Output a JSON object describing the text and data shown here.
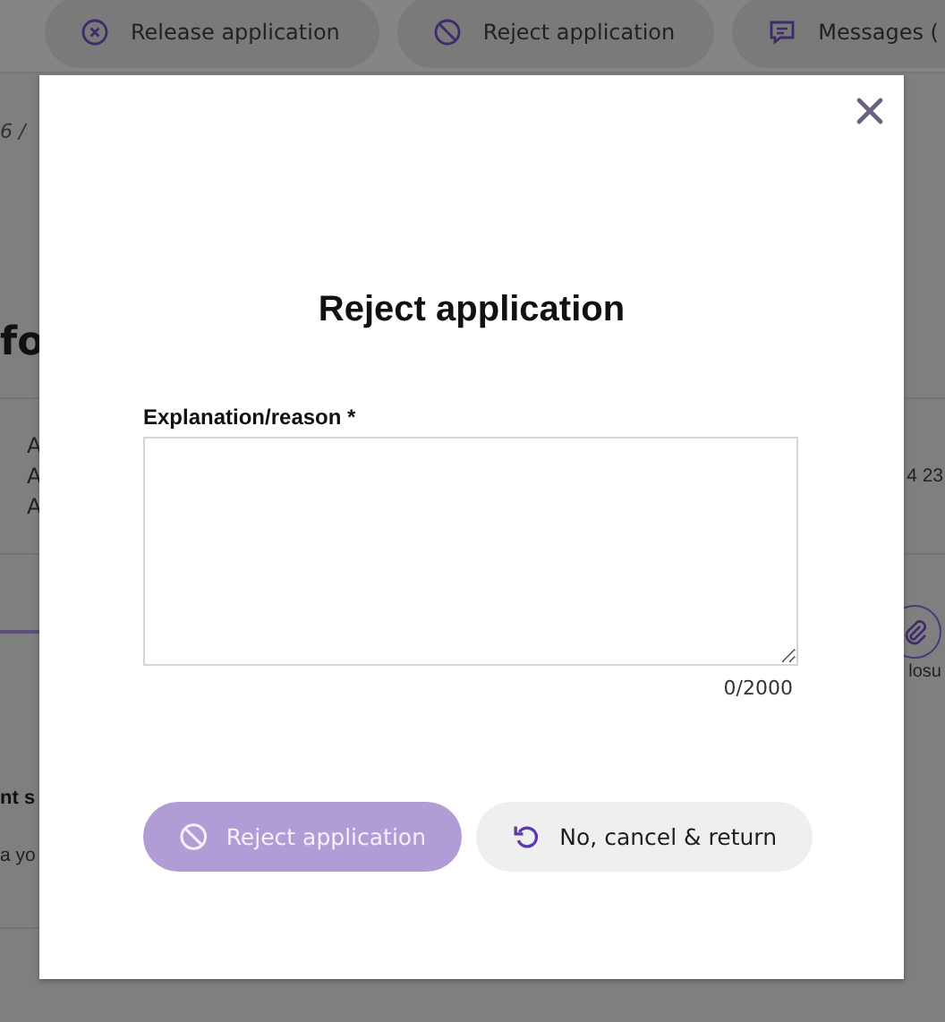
{
  "toolbar": [
    {
      "kind": "release",
      "label": "Release application"
    },
    {
      "kind": "reject",
      "label": "Reject application"
    },
    {
      "kind": "messages",
      "label": "Messages ("
    }
  ],
  "breadcrumb": "6 /",
  "heading": "fo",
  "details_left": [
    "A",
    "A",
    "A"
  ],
  "details_right": "4 23",
  "attachment_label": "losu",
  "section_heading": "nt s",
  "section_text": "a yo",
  "modal": {
    "title": "Reject application",
    "field_label": "Explanation/reason *",
    "counter": "0/2000",
    "buttons": [
      {
        "kind": "primary",
        "label": "Reject application",
        "disabled": true
      },
      {
        "kind": "secondary",
        "label": "No, cancel & return",
        "disabled": false
      }
    ]
  }
}
